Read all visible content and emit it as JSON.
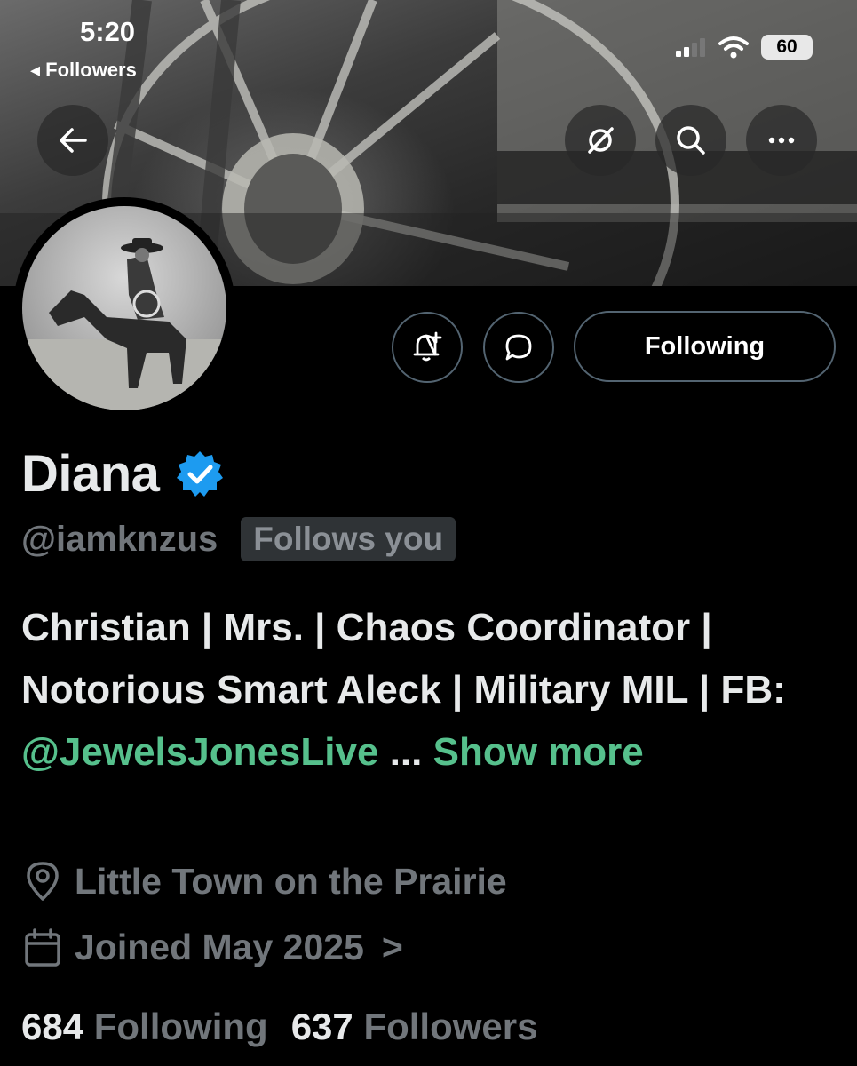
{
  "status_bar": {
    "time": "5:20",
    "back_label": "◂ Followers",
    "battery": "60"
  },
  "header": {
    "icons": [
      "back-arrow-icon",
      "grok-icon",
      "search-icon",
      "more-icon"
    ]
  },
  "actions": {
    "following_label": "Following"
  },
  "profile": {
    "name": "Diana",
    "verified": true,
    "handle": "@iamknzus",
    "follows_you": "Follows you",
    "bio_text": "Christian | Mrs. | Chaos Coordinator | Notorious Smart Aleck | Military MIL | FB:",
    "bio_mention": "@JewelsJonesLive",
    "bio_ellipsis": "...",
    "show_more": "Show more",
    "location": "Little Town on the Prairie",
    "joined": "Joined May 2025",
    "joined_chevron": ">",
    "following_count": "684",
    "following_label": "Following",
    "followers_count": "637",
    "followers_label": "Followers"
  },
  "colors": {
    "background": "#000000",
    "primary_text": "#e7e9ea",
    "secondary_text": "#71767b",
    "link": "#56c08c",
    "verified_badge": "#1d9bf0"
  }
}
